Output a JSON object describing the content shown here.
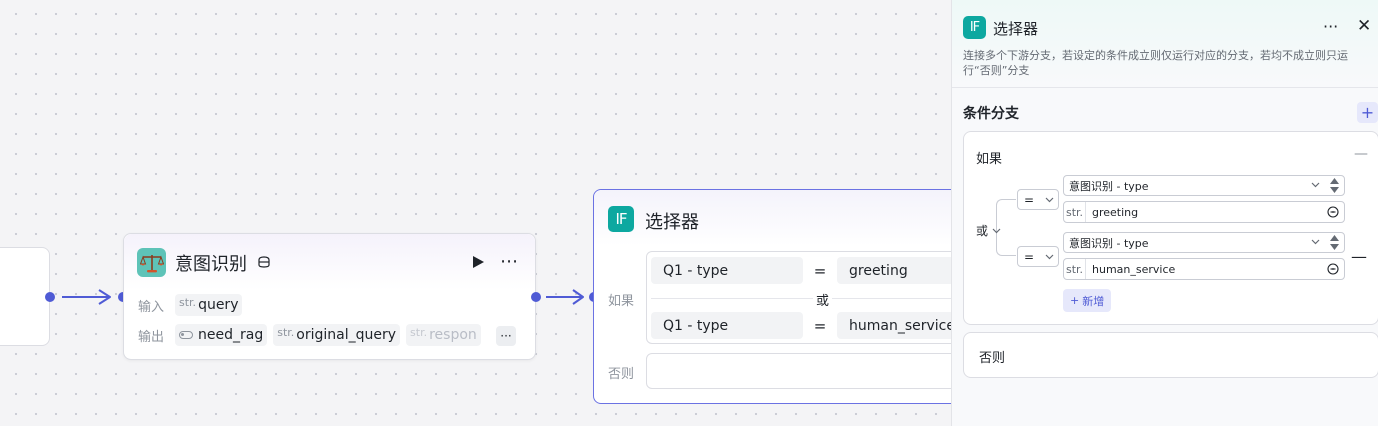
{
  "intent_node": {
    "title": "意图识别",
    "input_label": "输入",
    "output_label": "输出",
    "inputs": [
      {
        "type": "str.",
        "name": "query"
      }
    ],
    "outputs": [
      {
        "type": "toggle",
        "name": "need_rag"
      },
      {
        "type": "str.",
        "name": "original_query"
      },
      {
        "type": "str.",
        "name": "respon"
      }
    ],
    "more_outputs": "···"
  },
  "selector_node": {
    "icon_text": "IF",
    "title": "选择器",
    "if_label": "如果",
    "else_label": "否则",
    "or_label": "或",
    "conditions": [
      {
        "left": "Q1  -  type",
        "op": "=",
        "right": "greeting"
      },
      {
        "left": "Q1  -  type",
        "op": "=",
        "right": "human_service"
      }
    ]
  },
  "panel": {
    "icon_text": "IF",
    "title": "选择器",
    "more": "···",
    "close": "✕",
    "description": "连接多个下游分支，若设定的条件成立则仅运行对应的分支，若均不成立则只运行“否则”分支",
    "section_title": "条件分支",
    "add": "+",
    "if_card": {
      "title": "如果",
      "logic": "或",
      "collapse": "—",
      "conditions": [
        {
          "op": "=",
          "variable": "意图识别 - type",
          "value_type": "str.",
          "value": "greeting"
        },
        {
          "op": "=",
          "variable": "意图识别 - type",
          "value_type": "str.",
          "value": "human_service"
        }
      ],
      "add_condition": "新增",
      "remove": "—"
    },
    "else_card": {
      "title": "否则"
    }
  },
  "colors": {
    "accent": "#4f5bd5",
    "if_icon": "#0da8a0",
    "selected_border": "#6b72e3"
  }
}
